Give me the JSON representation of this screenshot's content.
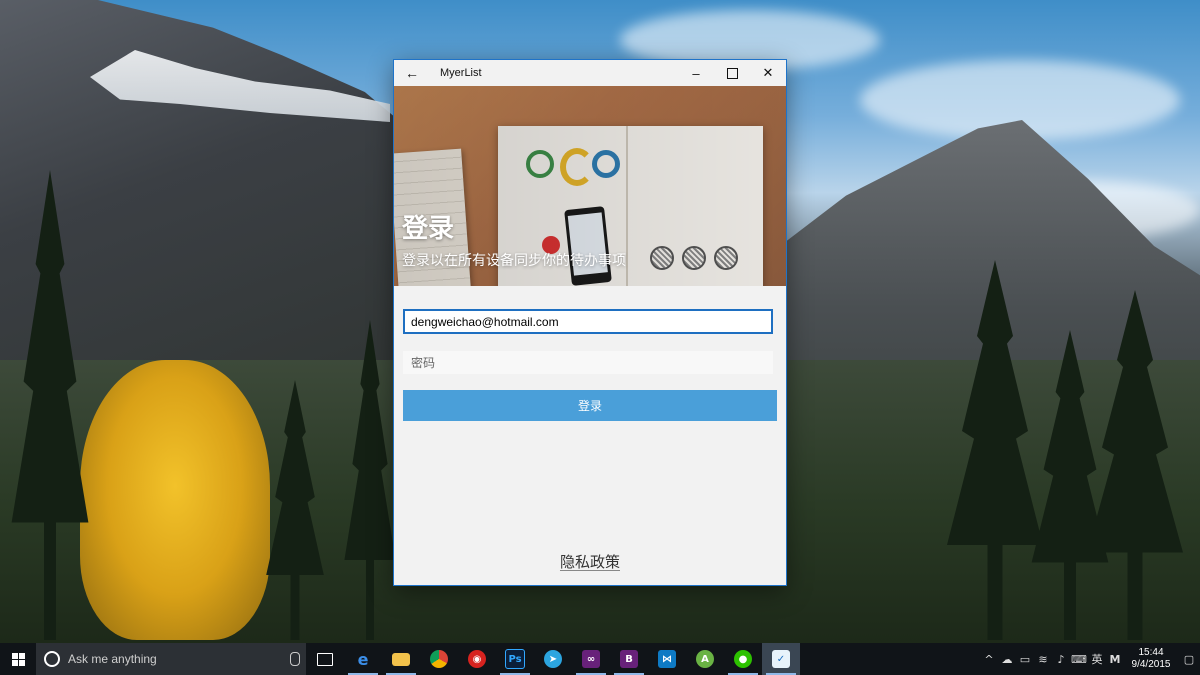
{
  "window": {
    "title": "MyerList",
    "back_icon": "arrow-left-icon"
  },
  "hero": {
    "title": "登录",
    "subtitle": "登录以在所有设备同步你的待办事项"
  },
  "form": {
    "email_value": "dengweichao@hotmail.com",
    "password_placeholder": "密码",
    "login_label": "登录"
  },
  "footer": {
    "privacy_label": "隐私政策"
  },
  "taskbar": {
    "search_placeholder": "Ask me anything",
    "apps": [
      {
        "name": "task-view-icon"
      },
      {
        "name": "edge-icon"
      },
      {
        "name": "file-explorer-icon"
      },
      {
        "name": "chrome-icon"
      },
      {
        "name": "netease-music-icon"
      },
      {
        "name": "photoshop-icon",
        "label": "Ps"
      },
      {
        "name": "telegram-icon"
      },
      {
        "name": "visual-studio-icon"
      },
      {
        "name": "visual-studio-blend-icon"
      },
      {
        "name": "visual-studio-code-icon"
      },
      {
        "name": "android-studio-icon"
      },
      {
        "name": "wechat-icon"
      },
      {
        "name": "myerlist-icon"
      }
    ],
    "tray": {
      "ime_label": "英",
      "input_mode": "M",
      "time": "15:44",
      "date": "9/4/2015"
    }
  },
  "colors": {
    "accent": "#1e6fc1",
    "button": "#4a9fd9",
    "taskbar": "#101418"
  }
}
